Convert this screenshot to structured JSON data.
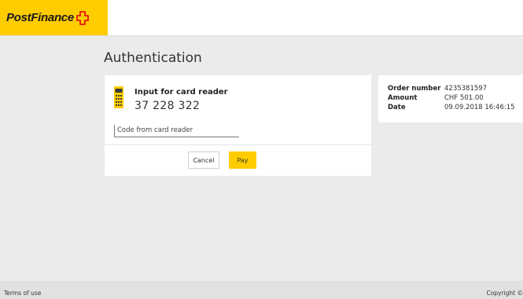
{
  "header": {
    "logo_text": "PostFinance",
    "brand_color": "#ffcc00",
    "cross_color": "#e3000f"
  },
  "main": {
    "title": "Authentication",
    "card_reader": {
      "icon": "card-reader-icon",
      "label": "Input for card reader",
      "code": "37 228 322"
    },
    "code_input": {
      "placeholder": "Code from card reader",
      "value": ""
    },
    "buttons": {
      "cancel": "Cancel",
      "pay": "Pay"
    }
  },
  "order": {
    "rows": [
      {
        "label": "Order number",
        "value": "4235381597"
      },
      {
        "label": "Amount",
        "value": "CHF 501.00"
      },
      {
        "label": "Date",
        "value": "09.09.2018 16:46:15"
      }
    ]
  },
  "footer": {
    "terms": "Terms of use",
    "copyright": "Copyright ©"
  }
}
